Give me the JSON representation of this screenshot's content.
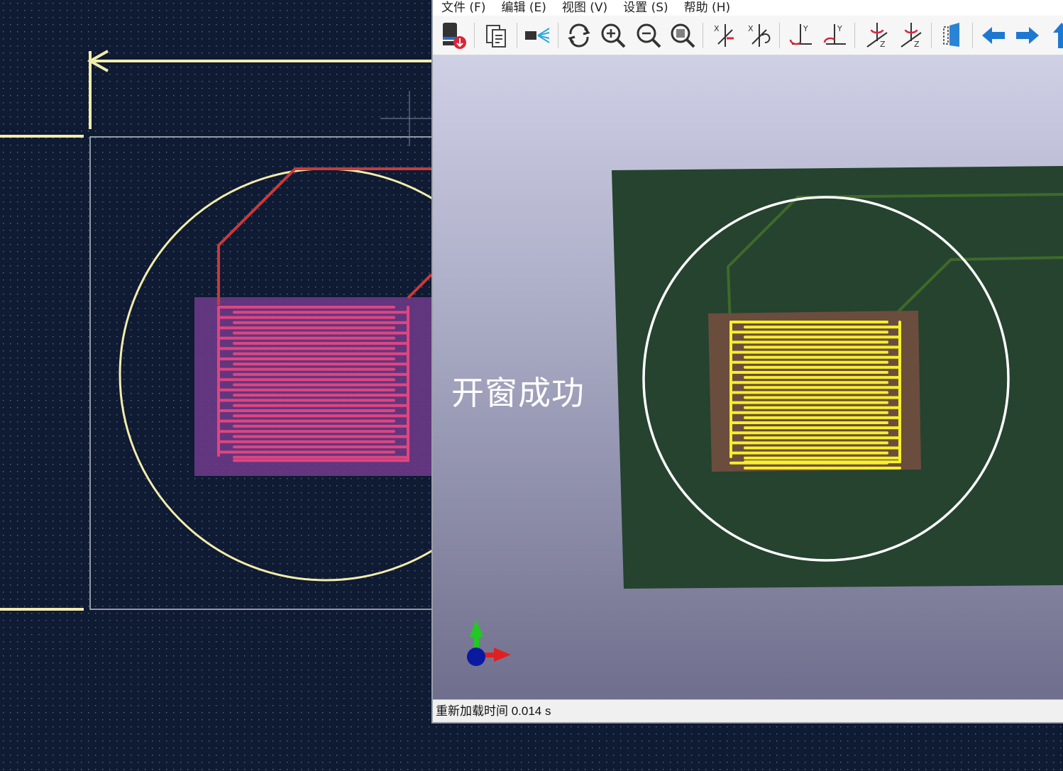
{
  "viewer": {
    "menu": [
      {
        "label": "文件 (F)"
      },
      {
        "label": "编辑 (E)"
      },
      {
        "label": "视图 (V)"
      },
      {
        "label": "设置 (S)"
      },
      {
        "label": "帮助 (H)"
      }
    ],
    "toolbar_icons": [
      "export-icon",
      "copy-icon",
      "camera-icon",
      "reload-icon",
      "zoom-in-icon",
      "zoom-out-icon",
      "zoom-fit-icon",
      "rotate-x-cw-icon",
      "rotate-x-ccw-icon",
      "rotate-y-cw-icon",
      "rotate-y-ccw-icon",
      "rotate-z-cw-icon",
      "rotate-z-ccw-icon",
      "flip-board-icon",
      "pan-left-icon",
      "pan-right-icon",
      "pan-up-icon"
    ],
    "annotation": "开窗成功",
    "status": "重新加载时间 0.014 s"
  },
  "colors": {
    "pcb_background": "#0f1a33",
    "silkscreen": "#f2ecaa",
    "copper_front": "#c93a3a",
    "pad_fill": "#6a3a86",
    "pad_trace": "#e0457f",
    "board_3d": "#25432f",
    "pad_3d": "#6b4d3e",
    "trace_3d": "#f7f02a"
  }
}
